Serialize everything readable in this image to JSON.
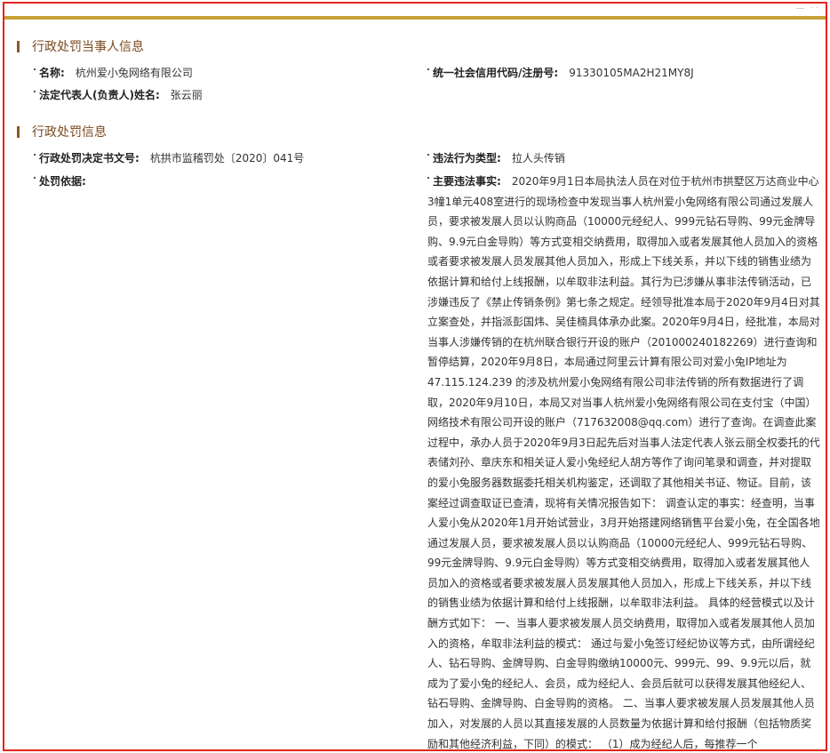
{
  "section1": {
    "title": "行政处罚当事人信息",
    "name_label": "名称:",
    "name_value": "杭州爱小兔网络有限公司",
    "credit_label": "统一社会信用代码/注册号:",
    "credit_value": "91330105MA2H21MY8J",
    "rep_label": "法定代表人(负责人)姓名:",
    "rep_value": "张云丽"
  },
  "section2": {
    "title": "行政处罚信息",
    "doc_label": "行政处罚决定书文号:",
    "doc_value": "杭拱市监稽罚处〔2020〕041号",
    "type_label": "违法行为类型:",
    "type_value": "拉人头传销",
    "basis_label": "处罚依据:",
    "facts_label": "主要违法事实:",
    "facts_text": "2020年9月1日本局执法人员在对位于杭州市拱墅区万达商业中心3幢1单元408室进行的现场检查中发现当事人杭州爱小兔网络有限公司通过发展人员，要求被发展人员以认购商品（10000元经纪人、999元钻石导购、99元金牌导购、9.9元白金导购）等方式变相交纳费用，取得加入或者发展其他人员加入的资格或者要求被发展人员发展其他人员加入，形成上下线关系，并以下线的销售业绩为依据计算和给付上线报酬，以牟取非法利益。其行为已涉嫌从事非法传销活动，已涉嫌违反了《禁止传销条例》第七条之规定。经领导批准本局于2020年9月4日对其立案查处，并指派彭国炜、吴佳楠具体承办此案。2020年9月4日，经批准，本局对当事人涉嫌传销的在杭州联合银行开设的账户（201000240182269）进行查询和暂停结算，2020年9月8日，本局通过阿里云计算有限公司对爱小兔IP地址为47.115.124.239 的涉及杭州爱小兔网络有限公司非法传销的所有数据进行了调取，2020年9月10日，本局又对当事人杭州爱小兔网络有限公司在支付宝（中国）网络技术有限公司开设的账户（717632008@qq.com）进行了查询。在调查此案过程中，承办人员于2020年9月3日起先后对当事人法定代表人张云丽全权委托的代表储刘孙、章庆东和相关证人爱小兔经纪人胡方等作了询问笔录和调查，并对提取的爱小兔服务器数据委托相关机构鉴定，还调取了其他相关书证、物证。目前，该案经过调查取证已查清，现将有关情况报告如下：  调查认定的事实：经查明，当事人爱小兔从2020年1月开始试营业，3月开始搭建网络销售平台爱小兔，在全国各地通过发展人员，要求被发展人员以认购商品（10000元经纪人、999元钻石导购、99元金牌导购、9.9元白金导购）等方式变相交纳费用，取得加入或者发展其他人员加入的资格或者要求被发展人员发展其他人员加入，形成上下线关系，并以下线的销售业绩为依据计算和给付上线报酬，以牟取非法利益。  具体的经营模式以及计酬方式如下：  一、当事人要求被发展人员交纳费用，取得加入或者发展其他人员加入的资格，牟取非法利益的模式：  通过与爱小兔签订经纪协议等方式，由所谓经纪人、钻石导购、金牌导购、白金导购缴纳10000元、999元、99、9.9元以后，就成为了爱小兔的经纪人、会员，成为经纪人、会员后就可以获得发展其他经纪人、钻石导购、金牌导购、白金导购的资格。 二、当事人要求被发展人员发展其他人员加入，对发展的人员以其直接发展的人员数量为依据计算和给付报酬（包括物质奖励和其他经济利益，下同）的模式：  （1）成为经纪人后，每推荐一个"
  }
}
